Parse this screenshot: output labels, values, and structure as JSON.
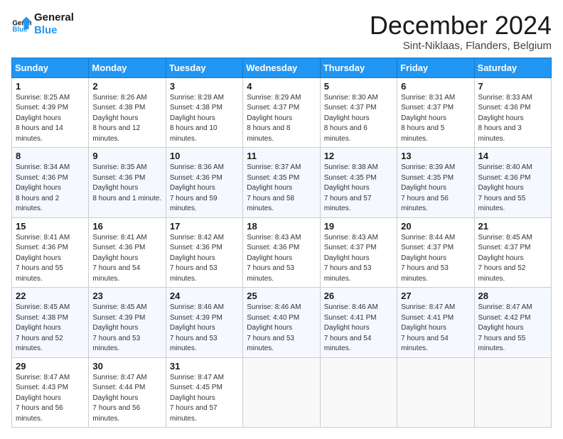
{
  "logo": {
    "line1": "General",
    "line2": "Blue"
  },
  "title": "December 2024",
  "location": "Sint-Niklaas, Flanders, Belgium",
  "header": {
    "accent_color": "#2196F3"
  },
  "days_of_week": [
    "Sunday",
    "Monday",
    "Tuesday",
    "Wednesday",
    "Thursday",
    "Friday",
    "Saturday"
  ],
  "weeks": [
    [
      {
        "day": "1",
        "sunrise": "8:25 AM",
        "sunset": "4:39 PM",
        "daylight": "8 hours and 14 minutes."
      },
      {
        "day": "2",
        "sunrise": "8:26 AM",
        "sunset": "4:38 PM",
        "daylight": "8 hours and 12 minutes."
      },
      {
        "day": "3",
        "sunrise": "8:28 AM",
        "sunset": "4:38 PM",
        "daylight": "8 hours and 10 minutes."
      },
      {
        "day": "4",
        "sunrise": "8:29 AM",
        "sunset": "4:37 PM",
        "daylight": "8 hours and 8 minutes."
      },
      {
        "day": "5",
        "sunrise": "8:30 AM",
        "sunset": "4:37 PM",
        "daylight": "8 hours and 6 minutes."
      },
      {
        "day": "6",
        "sunrise": "8:31 AM",
        "sunset": "4:37 PM",
        "daylight": "8 hours and 5 minutes."
      },
      {
        "day": "7",
        "sunrise": "8:33 AM",
        "sunset": "4:36 PM",
        "daylight": "8 hours and 3 minutes."
      }
    ],
    [
      {
        "day": "8",
        "sunrise": "8:34 AM",
        "sunset": "4:36 PM",
        "daylight": "8 hours and 2 minutes."
      },
      {
        "day": "9",
        "sunrise": "8:35 AM",
        "sunset": "4:36 PM",
        "daylight": "8 hours and 1 minute."
      },
      {
        "day": "10",
        "sunrise": "8:36 AM",
        "sunset": "4:36 PM",
        "daylight": "7 hours and 59 minutes."
      },
      {
        "day": "11",
        "sunrise": "8:37 AM",
        "sunset": "4:35 PM",
        "daylight": "7 hours and 58 minutes."
      },
      {
        "day": "12",
        "sunrise": "8:38 AM",
        "sunset": "4:35 PM",
        "daylight": "7 hours and 57 minutes."
      },
      {
        "day": "13",
        "sunrise": "8:39 AM",
        "sunset": "4:35 PM",
        "daylight": "7 hours and 56 minutes."
      },
      {
        "day": "14",
        "sunrise": "8:40 AM",
        "sunset": "4:36 PM",
        "daylight": "7 hours and 55 minutes."
      }
    ],
    [
      {
        "day": "15",
        "sunrise": "8:41 AM",
        "sunset": "4:36 PM",
        "daylight": "7 hours and 55 minutes."
      },
      {
        "day": "16",
        "sunrise": "8:41 AM",
        "sunset": "4:36 PM",
        "daylight": "7 hours and 54 minutes."
      },
      {
        "day": "17",
        "sunrise": "8:42 AM",
        "sunset": "4:36 PM",
        "daylight": "7 hours and 53 minutes."
      },
      {
        "day": "18",
        "sunrise": "8:43 AM",
        "sunset": "4:36 PM",
        "daylight": "7 hours and 53 minutes."
      },
      {
        "day": "19",
        "sunrise": "8:43 AM",
        "sunset": "4:37 PM",
        "daylight": "7 hours and 53 minutes."
      },
      {
        "day": "20",
        "sunrise": "8:44 AM",
        "sunset": "4:37 PM",
        "daylight": "7 hours and 53 minutes."
      },
      {
        "day": "21",
        "sunrise": "8:45 AM",
        "sunset": "4:37 PM",
        "daylight": "7 hours and 52 minutes."
      }
    ],
    [
      {
        "day": "22",
        "sunrise": "8:45 AM",
        "sunset": "4:38 PM",
        "daylight": "7 hours and 52 minutes."
      },
      {
        "day": "23",
        "sunrise": "8:45 AM",
        "sunset": "4:39 PM",
        "daylight": "7 hours and 53 minutes."
      },
      {
        "day": "24",
        "sunrise": "8:46 AM",
        "sunset": "4:39 PM",
        "daylight": "7 hours and 53 minutes."
      },
      {
        "day": "25",
        "sunrise": "8:46 AM",
        "sunset": "4:40 PM",
        "daylight": "7 hours and 53 minutes."
      },
      {
        "day": "26",
        "sunrise": "8:46 AM",
        "sunset": "4:41 PM",
        "daylight": "7 hours and 54 minutes."
      },
      {
        "day": "27",
        "sunrise": "8:47 AM",
        "sunset": "4:41 PM",
        "daylight": "7 hours and 54 minutes."
      },
      {
        "day": "28",
        "sunrise": "8:47 AM",
        "sunset": "4:42 PM",
        "daylight": "7 hours and 55 minutes."
      }
    ],
    [
      {
        "day": "29",
        "sunrise": "8:47 AM",
        "sunset": "4:43 PM",
        "daylight": "7 hours and 56 minutes."
      },
      {
        "day": "30",
        "sunrise": "8:47 AM",
        "sunset": "4:44 PM",
        "daylight": "7 hours and 56 minutes."
      },
      {
        "day": "31",
        "sunrise": "8:47 AM",
        "sunset": "4:45 PM",
        "daylight": "7 hours and 57 minutes."
      },
      null,
      null,
      null,
      null
    ]
  ]
}
